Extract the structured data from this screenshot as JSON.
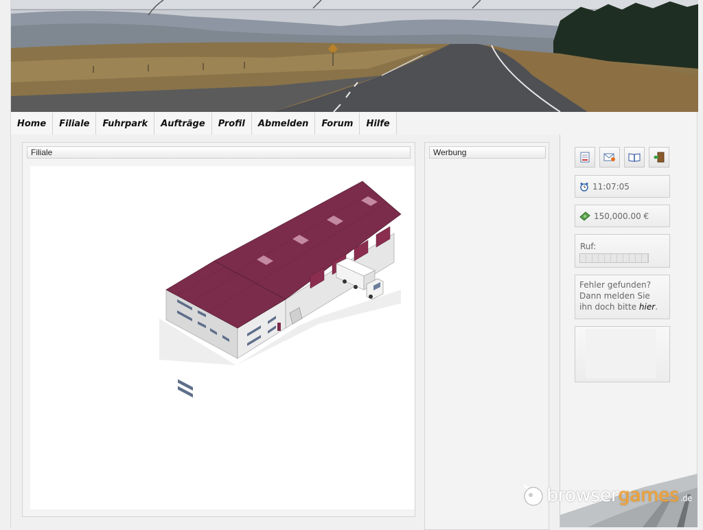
{
  "nav": {
    "items": [
      {
        "label": "Home"
      },
      {
        "label": "Filiale"
      },
      {
        "label": "Fuhrpark"
      },
      {
        "label": "Aufträge"
      },
      {
        "label": "Profil"
      },
      {
        "label": "Abmelden"
      },
      {
        "label": "Forum"
      },
      {
        "label": "Hilfe"
      }
    ]
  },
  "main": {
    "filiale_title": "Filiale",
    "werbung_title": "Werbung"
  },
  "sidebar": {
    "icons": [
      "document-icon",
      "mail-icon",
      "book-icon",
      "exit-door-icon"
    ],
    "time": "11:07:05",
    "money": "150,000.00 €",
    "ruf_label": "Ruf:",
    "ruf_level": 0,
    "fehler_text": "Fehler gefunden? Dann melden Sie ihn doch bitte",
    "fehler_link": "hier",
    "fehler_end": "."
  },
  "watermark": {
    "part1": "browser",
    "part2": "games",
    "suffix": ".de"
  },
  "colors": {
    "roof": "#7a2a48",
    "wall": "#e4e4e4",
    "accent_orange": "#f2a43a"
  }
}
